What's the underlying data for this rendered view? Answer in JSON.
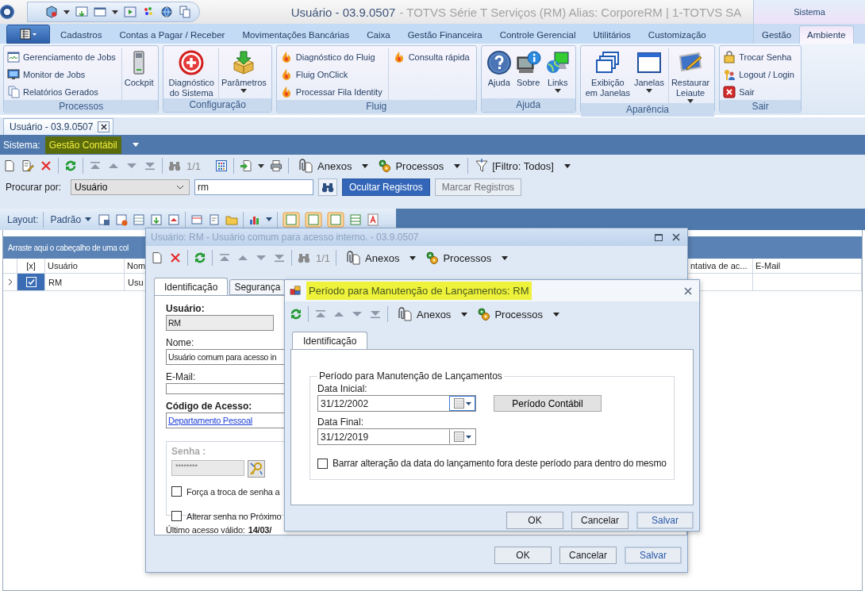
{
  "window": {
    "title": "Usuário - 03.9.0507",
    "subtitle": "- TOTVS Série T Serviços (RM) Alias: CorporeRM | 1-TOTVS SA",
    "context_group": "Sistema"
  },
  "ribbon": {
    "tabs": [
      {
        "label": "Cadastros",
        "selected": false
      },
      {
        "label": "Contas a Pagar / Receber",
        "selected": false
      },
      {
        "label": "Movimentações Bancárias",
        "selected": false
      },
      {
        "label": "Caixa",
        "selected": false
      },
      {
        "label": "Gestão Financeira",
        "selected": false
      },
      {
        "label": "Controle Gerencial",
        "selected": false
      },
      {
        "label": "Utilitários",
        "selected": false
      },
      {
        "label": "Customização",
        "selected": false
      }
    ],
    "context_tabs": [
      {
        "label": "Gestão",
        "selected": false
      },
      {
        "label": "Ambiente",
        "selected": true
      }
    ],
    "groups": [
      {
        "label": "Processos",
        "columns": [
          {
            "kind": "small",
            "items": [
              {
                "label": "Gerenciamento de Jobs"
              },
              {
                "label": "Monitor de Jobs"
              },
              {
                "label": "Relatórios Gerados"
              }
            ]
          },
          {
            "kind": "large",
            "items": [
              {
                "label": "Cockpit",
                "dropdown": false
              }
            ]
          }
        ]
      },
      {
        "label": "Configuração",
        "columns": [
          {
            "kind": "large",
            "items": [
              {
                "label": "Diagnóstico\ndo Sistema",
                "dropdown": false
              }
            ]
          },
          {
            "kind": "large",
            "items": [
              {
                "label": "Parâmetros",
                "dropdown": true
              }
            ]
          }
        ]
      },
      {
        "label": "Fluig",
        "columns": [
          {
            "kind": "small",
            "items": [
              {
                "label": "Diagnóstico do Fluig"
              },
              {
                "label": "Fluig OnClick"
              },
              {
                "label": "Processar Fila Identity"
              }
            ]
          },
          {
            "kind": "small",
            "items": [
              {
                "label": "Consulta rápida"
              }
            ]
          }
        ]
      },
      {
        "label": "Ajuda",
        "columns": [
          {
            "kind": "large",
            "items": [
              {
                "label": "Ajuda",
                "dropdown": false
              },
              {
                "label": "Sobre",
                "dropdown": false
              },
              {
                "label": "Links",
                "dropdown": true
              }
            ]
          }
        ]
      },
      {
        "label": "Aparência",
        "columns": [
          {
            "kind": "large",
            "items": [
              {
                "label": "Exibição\nem Janelas",
                "dropdown": false
              },
              {
                "label": "Janelas",
                "dropdown": true
              }
            ]
          },
          {
            "kind": "large",
            "items": [
              {
                "label": "Restaurar\nLeiaute",
                "dropdown": true
              }
            ]
          }
        ]
      },
      {
        "label": "Sair",
        "columns": [
          {
            "kind": "small",
            "items": [
              {
                "label": "Trocar Senha"
              },
              {
                "label": "Logout / Login"
              },
              {
                "label": "Sair"
              }
            ]
          }
        ]
      }
    ]
  },
  "document_tab": {
    "label": "Usuário - 03.9.0507"
  },
  "system_bar": {
    "label": "Sistema:",
    "value": "Gestão Contábil",
    "highlighted": true
  },
  "toolbar": {
    "counter": "1/1",
    "menus": [
      "Anexos",
      "Processos",
      "[Filtro: Todos]"
    ]
  },
  "search": {
    "label": "Procurar por:",
    "field": "Usuário",
    "value": "rm",
    "buttons": [
      {
        "label": "Ocultar Registros",
        "primary": true
      },
      {
        "label": "Marcar Registros",
        "primary": false
      }
    ]
  },
  "layout_bar": {
    "label": "Layout:",
    "preset": "Padrão"
  },
  "grid": {
    "group_hint": "Arraste aqui o cabeçalho de uma col",
    "check_column": "[x]",
    "columns": [
      "Usuário",
      "Nom",
      "ntativa de ac...",
      "E-Mail"
    ],
    "rows": [
      {
        "selected": true,
        "checked": true,
        "cells": [
          "RM",
          "Usu"
        ]
      }
    ]
  },
  "user_dialog": {
    "title": "Usuário: RM - Usuário comum para acesso interno. - 03.9.0507",
    "active": false,
    "toolbar": {
      "counter": "1/1",
      "menus": [
        "Anexos",
        "Processos"
      ]
    },
    "tabs": [
      {
        "label": "Identificação",
        "selected": true
      },
      {
        "label": "Segurança",
        "selected": false
      }
    ],
    "fields": [
      {
        "label": "Usuário:",
        "value": "RM",
        "kind": "readonly",
        "bold": true
      },
      {
        "label": "Nome:",
        "value": "Usuário comum para acesso in",
        "kind": "text",
        "bold": false
      },
      {
        "label": "E-Mail:",
        "kind": "text",
        "bold": false
      },
      {
        "label": "Código de Acesso:",
        "value": "Departamento Pessoal",
        "kind": "link",
        "bold": true
      }
    ],
    "password": {
      "label": "Senha :",
      "value": "********",
      "disabled": true
    },
    "options": [
      {
        "label": "Força a troca de senha a",
        "checked": false
      },
      {
        "label": "Alterar senha no Próximo",
        "checked": false
      }
    ],
    "last_access": {
      "label": "Último acesso válido:",
      "value": "14/03/"
    },
    "buttons": [
      {
        "label": "OK",
        "default": false
      },
      {
        "label": "Cancelar",
        "default": false
      },
      {
        "label": "Salvar",
        "default": true
      }
    ]
  },
  "period_dialog": {
    "title": "Período para Manutenção de Lançamentos: RM",
    "highlighted": true,
    "toolbar": {
      "menus": [
        "Anexos",
        "Processos"
      ]
    },
    "tabs": [
      {
        "label": "Identificação",
        "selected": true
      }
    ],
    "group_title": "Período para Manutenção de Lançamentos",
    "dates": [
      {
        "label": "Data Inicial:",
        "value": "31/12/2002",
        "focused": true
      },
      {
        "label": "Data Final:",
        "value": "31/12/2019",
        "focused": false
      }
    ],
    "period_button": "Período Contábil",
    "option": {
      "label": "Barrar alteração da data do lançamento fora deste período para dentro do mesmo",
      "checked": false
    },
    "buttons": [
      {
        "label": "OK",
        "default": false
      },
      {
        "label": "Cancelar",
        "default": false
      },
      {
        "label": "Salvar",
        "default": true
      }
    ]
  }
}
